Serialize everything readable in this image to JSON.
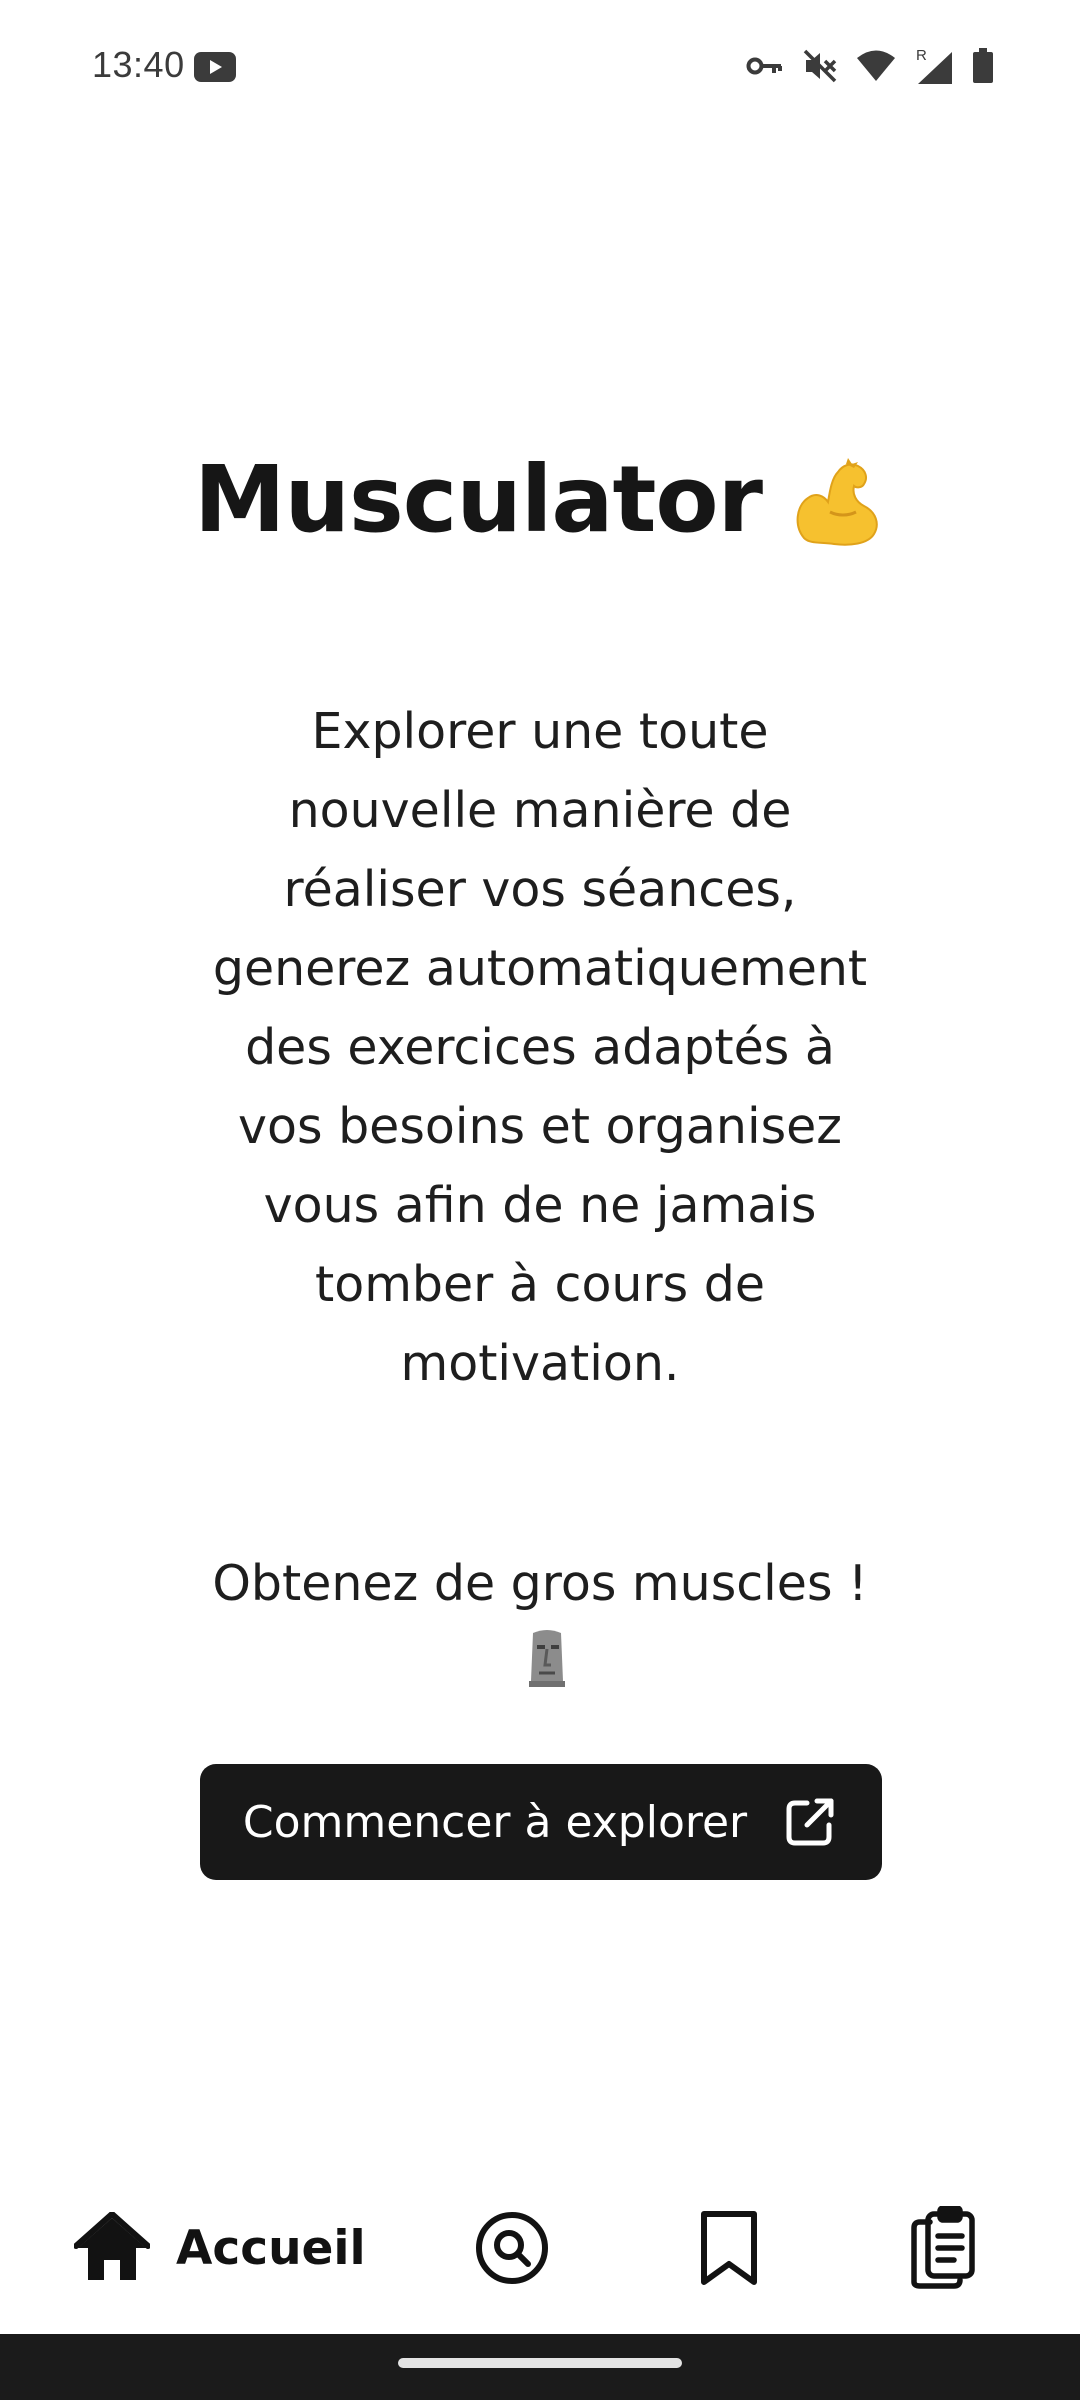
{
  "status_bar": {
    "time": "13:40",
    "icons": [
      "youtube-icon",
      "vpn-key-icon",
      "vibrate-off-icon",
      "wifi-icon",
      "signal-roaming-icon",
      "battery-icon"
    ]
  },
  "home": {
    "title": "Musculator",
    "title_emoji": "flexed-biceps-icon",
    "description": "Explorer une toute nouvelle manière de réaliser vos séances, generez automatiquement des exercices adaptés à vos besoins et organisez vous afin de ne jamais tomber à cours de motivation.",
    "tagline": "Obtenez de gros muscles !",
    "tagline_emoji": "moai-icon",
    "cta_label": "Commencer à explorer",
    "cta_icon": "external-link-icon"
  },
  "bottom_nav": {
    "items": [
      {
        "label": "Accueil",
        "icon": "home-icon",
        "active": true
      },
      {
        "label": "",
        "icon": "search-icon",
        "active": false
      },
      {
        "label": "",
        "icon": "bookmark-icon",
        "active": false
      },
      {
        "label": "",
        "icon": "clipboard-list-icon",
        "active": false
      }
    ]
  },
  "colors": {
    "background": "#ffffff",
    "text": "#1a1a1a",
    "button_bg": "#181818",
    "button_text": "#ffffff",
    "gesture_bar": "#1b1b1b"
  }
}
